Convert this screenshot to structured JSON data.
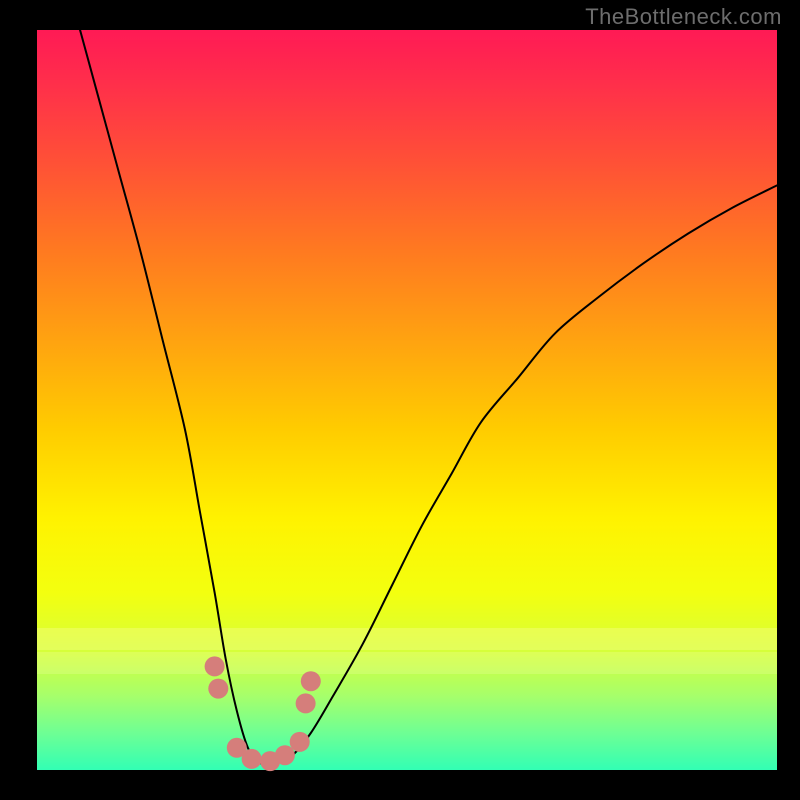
{
  "watermark": "TheBottleneck.com",
  "chart_data": {
    "type": "line",
    "title": "",
    "xlabel": "",
    "ylabel": "",
    "xlim": [
      0,
      100
    ],
    "ylim": [
      0,
      100
    ],
    "series": [
      {
        "name": "curve",
        "x": [
          5,
          8,
          11,
          14,
          17,
          20,
          22,
          24,
          25.5,
          27,
          28.5,
          30,
          32,
          34.5,
          37,
          40,
          44,
          48,
          52,
          56,
          60,
          65,
          70,
          76,
          82,
          88,
          94,
          100
        ],
        "y": [
          103,
          92,
          81,
          70,
          58,
          46,
          35,
          24,
          15,
          8,
          3,
          1,
          1,
          2,
          5,
          10,
          17,
          25,
          33,
          40,
          47,
          53,
          59,
          64,
          68.5,
          72.5,
          76,
          79
        ]
      }
    ],
    "markers": {
      "name": "highlighted-points",
      "color": "#d57e7b",
      "points": [
        {
          "x": 24.0,
          "y": 14.0
        },
        {
          "x": 24.5,
          "y": 11.0
        },
        {
          "x": 27.0,
          "y": 3.0
        },
        {
          "x": 29.0,
          "y": 1.5
        },
        {
          "x": 31.5,
          "y": 1.2
        },
        {
          "x": 33.5,
          "y": 2.0
        },
        {
          "x": 35.5,
          "y": 3.8
        },
        {
          "x": 36.3,
          "y": 9.0
        },
        {
          "x": 37.0,
          "y": 12.0
        }
      ]
    }
  }
}
